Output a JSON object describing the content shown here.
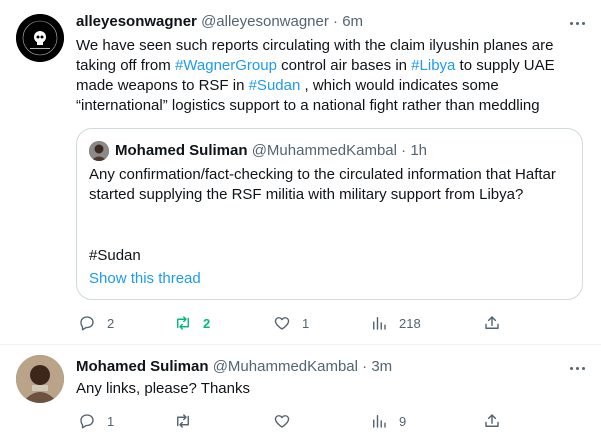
{
  "tweets": [
    {
      "name": "alleyesonwagner",
      "handle": "@alleyesonwagner",
      "separator": "·",
      "time": "6m",
      "text_parts": {
        "p1": "We have seen such reports circulating with the claim ilyushin planes are taking off from ",
        "l1": "#WagnerGroup",
        "p2": " control air bases in ",
        "l2": "#Libya",
        "p3": " to supply UAE made weapons to RSF in ",
        "l3": "#Sudan",
        "p4": " , which would indicates some “international” logistics support to a national fight rather than meddling"
      },
      "avatar_icon": "wagner-logo-icon",
      "quote": {
        "name": "Mohamed Suliman",
        "handle": "@MuhammedKambal",
        "separator": "·",
        "time": "1h",
        "text": "Any confirmation/fact-checking to the circulated information that Haftar started supplying the RSF militia with military support from Libya?",
        "hashtag": "#Sudan",
        "show_thread": "Show this thread"
      },
      "actions": {
        "replies": "2",
        "retweets": "2",
        "likes": "1",
        "views": "218"
      }
    },
    {
      "name": "Mohamed Suliman",
      "handle": "@MuhammedKambal",
      "separator": "·",
      "time": "3m",
      "text": "Any links, please? Thanks",
      "actions": {
        "replies": "1",
        "retweets": "",
        "likes": "",
        "views": "9"
      }
    }
  ],
  "colors": {
    "link": "#1d9bf0",
    "secondary": "#536471",
    "retweet_active": "#00ba7c",
    "border": "#cfd9de"
  }
}
